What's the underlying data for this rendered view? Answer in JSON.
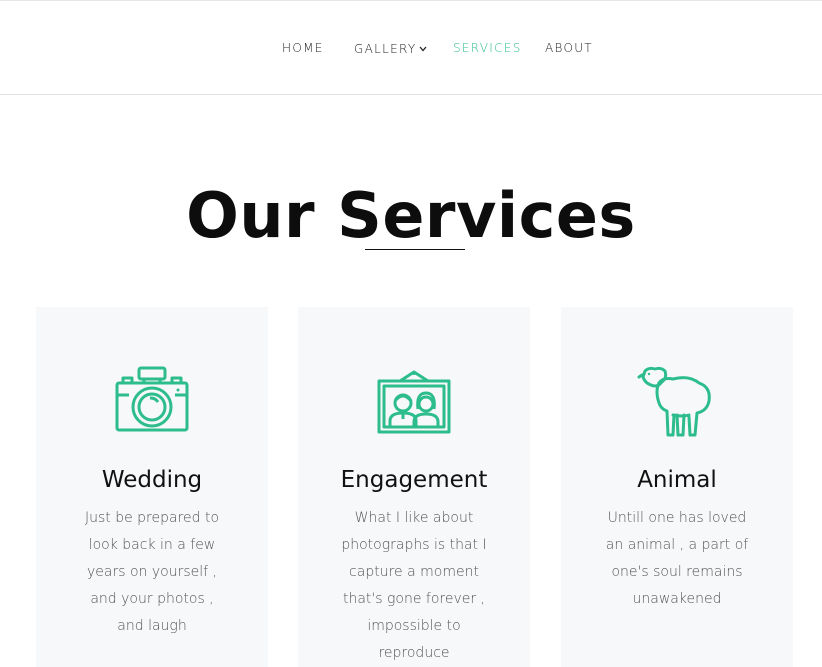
{
  "nav": {
    "items": [
      {
        "label": "HOME"
      },
      {
        "label": "GALLERY"
      },
      {
        "label": "SERVICES"
      },
      {
        "label": "ABOUT"
      }
    ]
  },
  "page": {
    "title": "Our Services"
  },
  "services": [
    {
      "title": "Wedding",
      "icon": "camera-icon",
      "text": "Just be prepared to look back in a few years on yourself , and your photos , and laugh"
    },
    {
      "title": "Engagement",
      "icon": "couple-portrait-icon",
      "text": "What I like about photographs is that I capture a moment that's gone forever , impossible to reproduce"
    },
    {
      "title": "Animal",
      "icon": "sheep-icon",
      "text": "Untill one has loved an animal , a part of one's soul remains unawakened"
    }
  ],
  "colors": {
    "accent": "#2dbd8c",
    "card_bg": "#f7f8f9"
  }
}
